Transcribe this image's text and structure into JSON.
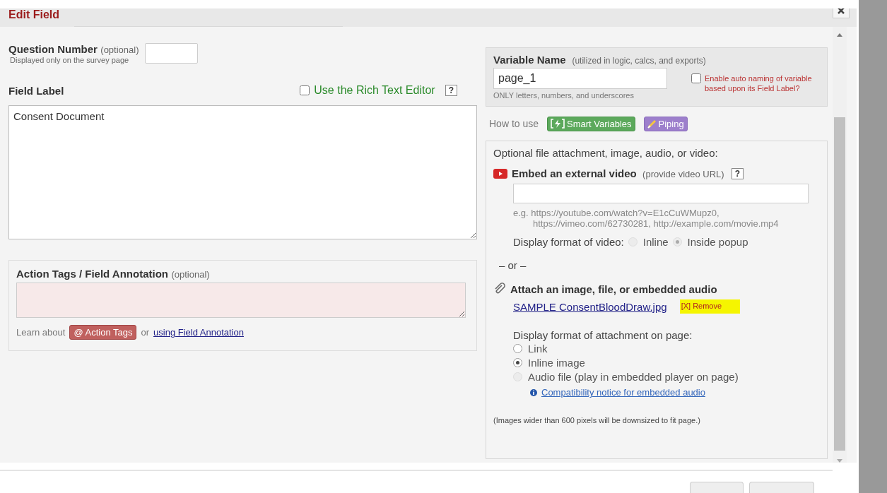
{
  "dialog": {
    "title": "Edit Field"
  },
  "question_number": {
    "label": "Question Number",
    "hint": "(optional)",
    "note": "Displayed only on the survey page"
  },
  "field_label": {
    "label": "Field Label",
    "rich_text": {
      "label": "Use the Rich Text Editor",
      "checked": false
    },
    "help": "?",
    "value": "Consent Document"
  },
  "action_tags": {
    "label": "Action Tags / Field Annotation",
    "hint": "(optional)",
    "learn_about": "Learn about",
    "tag_button": "@ Action Tags",
    "or": "or",
    "link": "using Field Annotation"
  },
  "variable": {
    "label": "Variable Name",
    "hint": "(utilized in logic, calcs, and exports)",
    "value": "page_1",
    "note": "ONLY letters, numbers, and underscores",
    "auto_naming": {
      "label": "Enable auto naming of variable based upon its Field Label?",
      "checked": false
    }
  },
  "how_to_use": {
    "label": "How to use",
    "buttons": [
      {
        "kind": "smart",
        "label": "Smart Variables"
      },
      {
        "kind": "piping",
        "label": "Piping"
      }
    ]
  },
  "attachment": {
    "title": "Optional file attachment, image, audio, or video:",
    "video": {
      "label": "Embed an external video",
      "hint": "(provide video URL)",
      "help": "?",
      "example_1": "e.g. https://youtube.com/watch?v=E1cCuWMupz0,",
      "example_2": "https://vimeo.com/62730281, http://example.com/movie.mp4",
      "format_label": "Display format of video:",
      "options": [
        {
          "label": "Inline",
          "selected": false
        },
        {
          "label": "Inside popup",
          "selected": true
        }
      ]
    },
    "or": "– or –",
    "attach": {
      "label": "Attach an image, file, or embedded audio",
      "file": "SAMPLE ConsentBloodDraw.jpg",
      "remove": "[X] Remove",
      "format_label": "Display format of attachment on page:",
      "options": [
        {
          "label": "Link",
          "selected": false,
          "disabled": false
        },
        {
          "label": "Inline image",
          "selected": true,
          "disabled": false
        },
        {
          "label": "Audio file (play in embedded player on page)",
          "selected": false,
          "disabled": true
        }
      ],
      "compat_link": "Compatibility notice for embedded audio",
      "note": "(Images wider than 600 pixels will be downsized to fit page.)"
    }
  }
}
